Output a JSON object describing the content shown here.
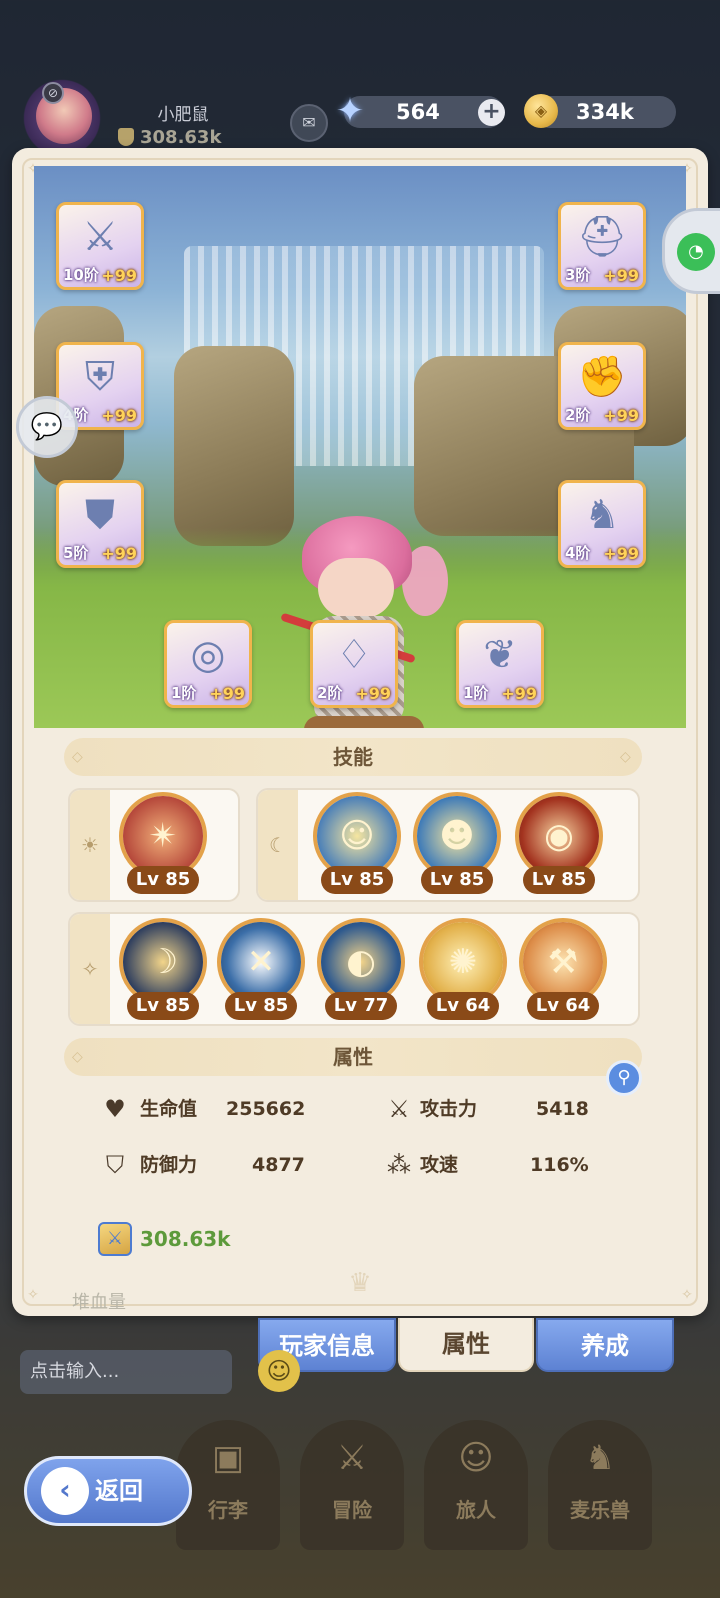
{
  "player": {
    "name": "小肥鼠",
    "power": "308.63k"
  },
  "currency": {
    "gems": "564",
    "gold": "334k"
  },
  "equipment": [
    {
      "slot": "weapon",
      "tier": "10阶",
      "plus": "+99",
      "icon": "sword-icon"
    },
    {
      "slot": "helmet",
      "tier": "3阶",
      "plus": "+99",
      "icon": "helmet-icon"
    },
    {
      "slot": "chest",
      "tier": "4阶",
      "plus": "+99",
      "icon": "chest-armor-icon"
    },
    {
      "slot": "gloves",
      "tier": "2阶",
      "plus": "+99",
      "icon": "gauntlet-icon"
    },
    {
      "slot": "pants",
      "tier": "5阶",
      "plus": "+99",
      "icon": "leg-armor-icon"
    },
    {
      "slot": "boots",
      "tier": "4阶",
      "plus": "+99",
      "icon": "boots-icon"
    },
    {
      "slot": "ring",
      "tier": "1阶",
      "plus": "+99",
      "icon": "ring-icon"
    },
    {
      "slot": "necklace",
      "tier": "2阶",
      "plus": "+99",
      "icon": "necklace-icon"
    },
    {
      "slot": "charm",
      "tier": "1阶",
      "plus": "+99",
      "icon": "charm-icon"
    }
  ],
  "skills_section": {
    "title": "技能",
    "sun_group": [
      {
        "level": "Lv 85",
        "icon": "shuriken-skill-icon"
      }
    ],
    "moon_group": [
      {
        "level": "Lv 85",
        "icon": "blond-hero-skill-icon"
      },
      {
        "level": "Lv 85",
        "icon": "blond-hero-blue-skill-icon"
      },
      {
        "level": "Lv 85",
        "icon": "vortex-skill-icon"
      }
    ],
    "star_group": [
      {
        "level": "Lv 85",
        "icon": "crescent-skill-icon"
      },
      {
        "level": "Lv 85",
        "icon": "slash-burst-skill-icon"
      },
      {
        "level": "Lv 77",
        "icon": "eye-skill-icon"
      },
      {
        "level": "Lv 64",
        "icon": "radiant-eye-skill-icon"
      },
      {
        "level": "Lv 64",
        "icon": "hammer-skill-icon"
      }
    ]
  },
  "attributes": {
    "title": "属性",
    "hp_label": "生命值",
    "hp_value": "255662",
    "atk_label": "攻击力",
    "atk_value": "5418",
    "def_label": "防御力",
    "def_value": "4877",
    "spd_label": "攻速",
    "spd_value": "116%",
    "power_value": "308.63k"
  },
  "panel_tabs": {
    "info": "玩家信息",
    "attributes": "属性",
    "training": "养成"
  },
  "under_panel_text": "堆血量",
  "chat": {
    "placeholder": "点击输入..."
  },
  "nav": {
    "inventory": "行李",
    "adventure": "冒险",
    "travelers": "旅人",
    "pets": "麦乐兽"
  },
  "back_label": "返回",
  "colors": {
    "accent_blue": "#5d82d3",
    "frame_gold": "#f0b44c",
    "panel_bg": "#f3ecdf",
    "power_green": "#5d9a3b"
  }
}
